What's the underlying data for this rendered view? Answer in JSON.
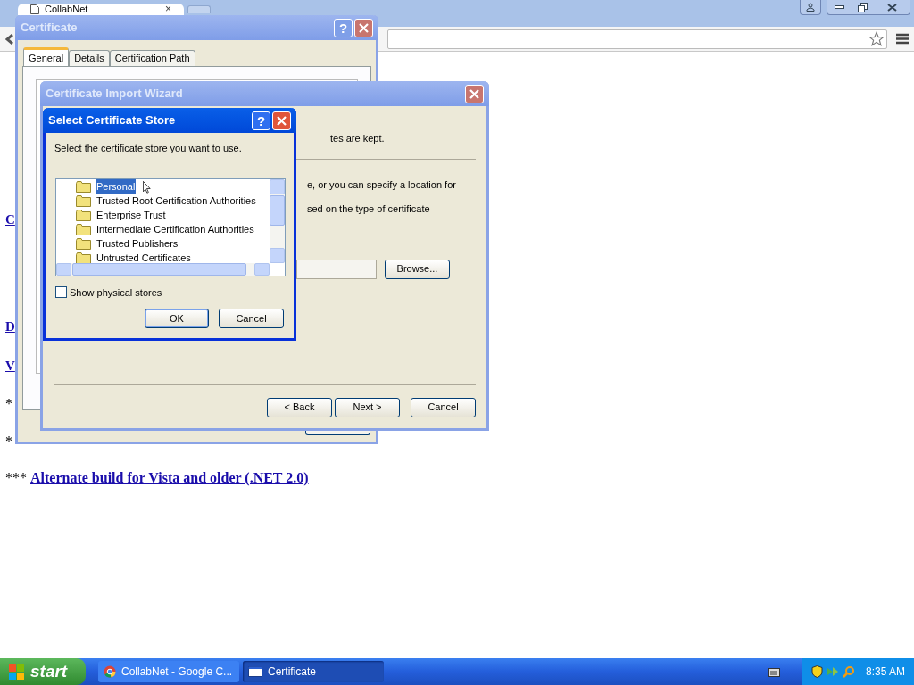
{
  "browser": {
    "tab_title": "CollabNet",
    "tab_close": "×"
  },
  "page": {
    "fragments": [
      {
        "kind": "heading_gap"
      },
      {
        "kind": "section_gap"
      },
      {
        "kind": "link",
        "text": "C"
      },
      {
        "kind": "section_gap"
      },
      {
        "kind": "link",
        "text": "D"
      },
      {
        "kind": "link",
        "text": "V"
      },
      {
        "kind": "text",
        "text": "*"
      },
      {
        "kind": "text",
        "text": "*"
      }
    ],
    "last_line": {
      "prefix": "***",
      "link": "Alternate build for Vista and older (.NET 2.0)"
    }
  },
  "certificate_window": {
    "title": "Certificate",
    "help": "?",
    "tabs": [
      {
        "label": "General",
        "selected": true
      },
      {
        "label": "Details",
        "selected": false
      },
      {
        "label": "Certification Path",
        "selected": false
      }
    ]
  },
  "import_wizard": {
    "title": "Certificate Import Wizard",
    "texts": [
      "tes are kept.",
      "e, or you can specify a location for",
      "sed on the type of certificate"
    ],
    "browse": "Browse...",
    "buttons": [
      "< Back",
      "Next >",
      "Cancel"
    ]
  },
  "store_dialog": {
    "title": "Select Certificate Store",
    "help": "?",
    "prompt": "Select the certificate store you want to use.",
    "stores": [
      {
        "name": "Personal",
        "selected": true
      },
      {
        "name": "Trusted Root Certification Authorities",
        "selected": false
      },
      {
        "name": "Enterprise Trust",
        "selected": false
      },
      {
        "name": "Intermediate Certification Authorities",
        "selected": false
      },
      {
        "name": "Trusted Publishers",
        "selected": false
      },
      {
        "name": "Untrusted Certificates",
        "selected": false
      }
    ],
    "show_physical": {
      "label": "Show physical stores",
      "checked": false
    },
    "ok": "OK",
    "cancel": "Cancel"
  },
  "taskbar": {
    "start": "start",
    "tasks": [
      {
        "label": "CollabNet - Google C...",
        "kind": "browser",
        "selected": false
      },
      {
        "label": "Certificate",
        "kind": "window",
        "selected": true
      }
    ],
    "clock": "8:35 AM"
  }
}
